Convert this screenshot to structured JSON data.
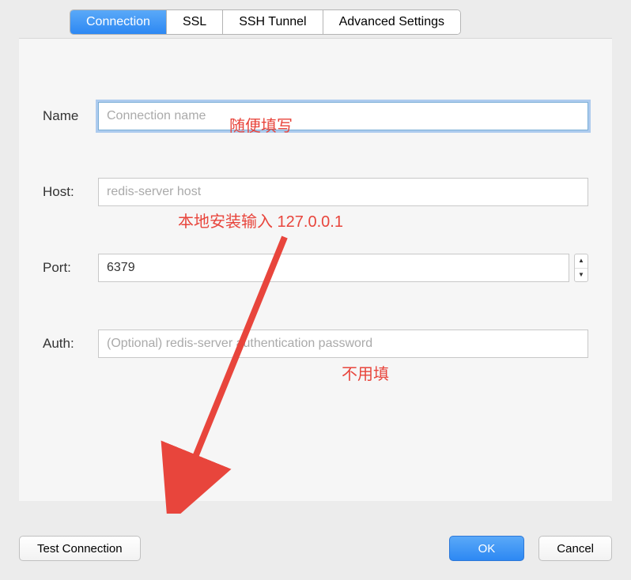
{
  "tabs": {
    "connection": "Connection",
    "ssl": "SSL",
    "ssh_tunnel": "SSH Tunnel",
    "advanced": "Advanced Settings"
  },
  "form": {
    "name": {
      "label": "Name",
      "placeholder": "Connection name",
      "value": ""
    },
    "host": {
      "label": "Host:",
      "placeholder": "redis-server host",
      "value": ""
    },
    "port": {
      "label": "Port:",
      "value": "6379"
    },
    "auth": {
      "label": "Auth:",
      "placeholder": "(Optional) redis-server authentication password",
      "value": ""
    }
  },
  "buttons": {
    "test": "Test Connection",
    "ok": "OK",
    "cancel": "Cancel"
  },
  "annotations": {
    "name_hint": "随便填写",
    "host_hint": "本地安装输入 127.0.0.1",
    "auth_hint": "不用填"
  }
}
